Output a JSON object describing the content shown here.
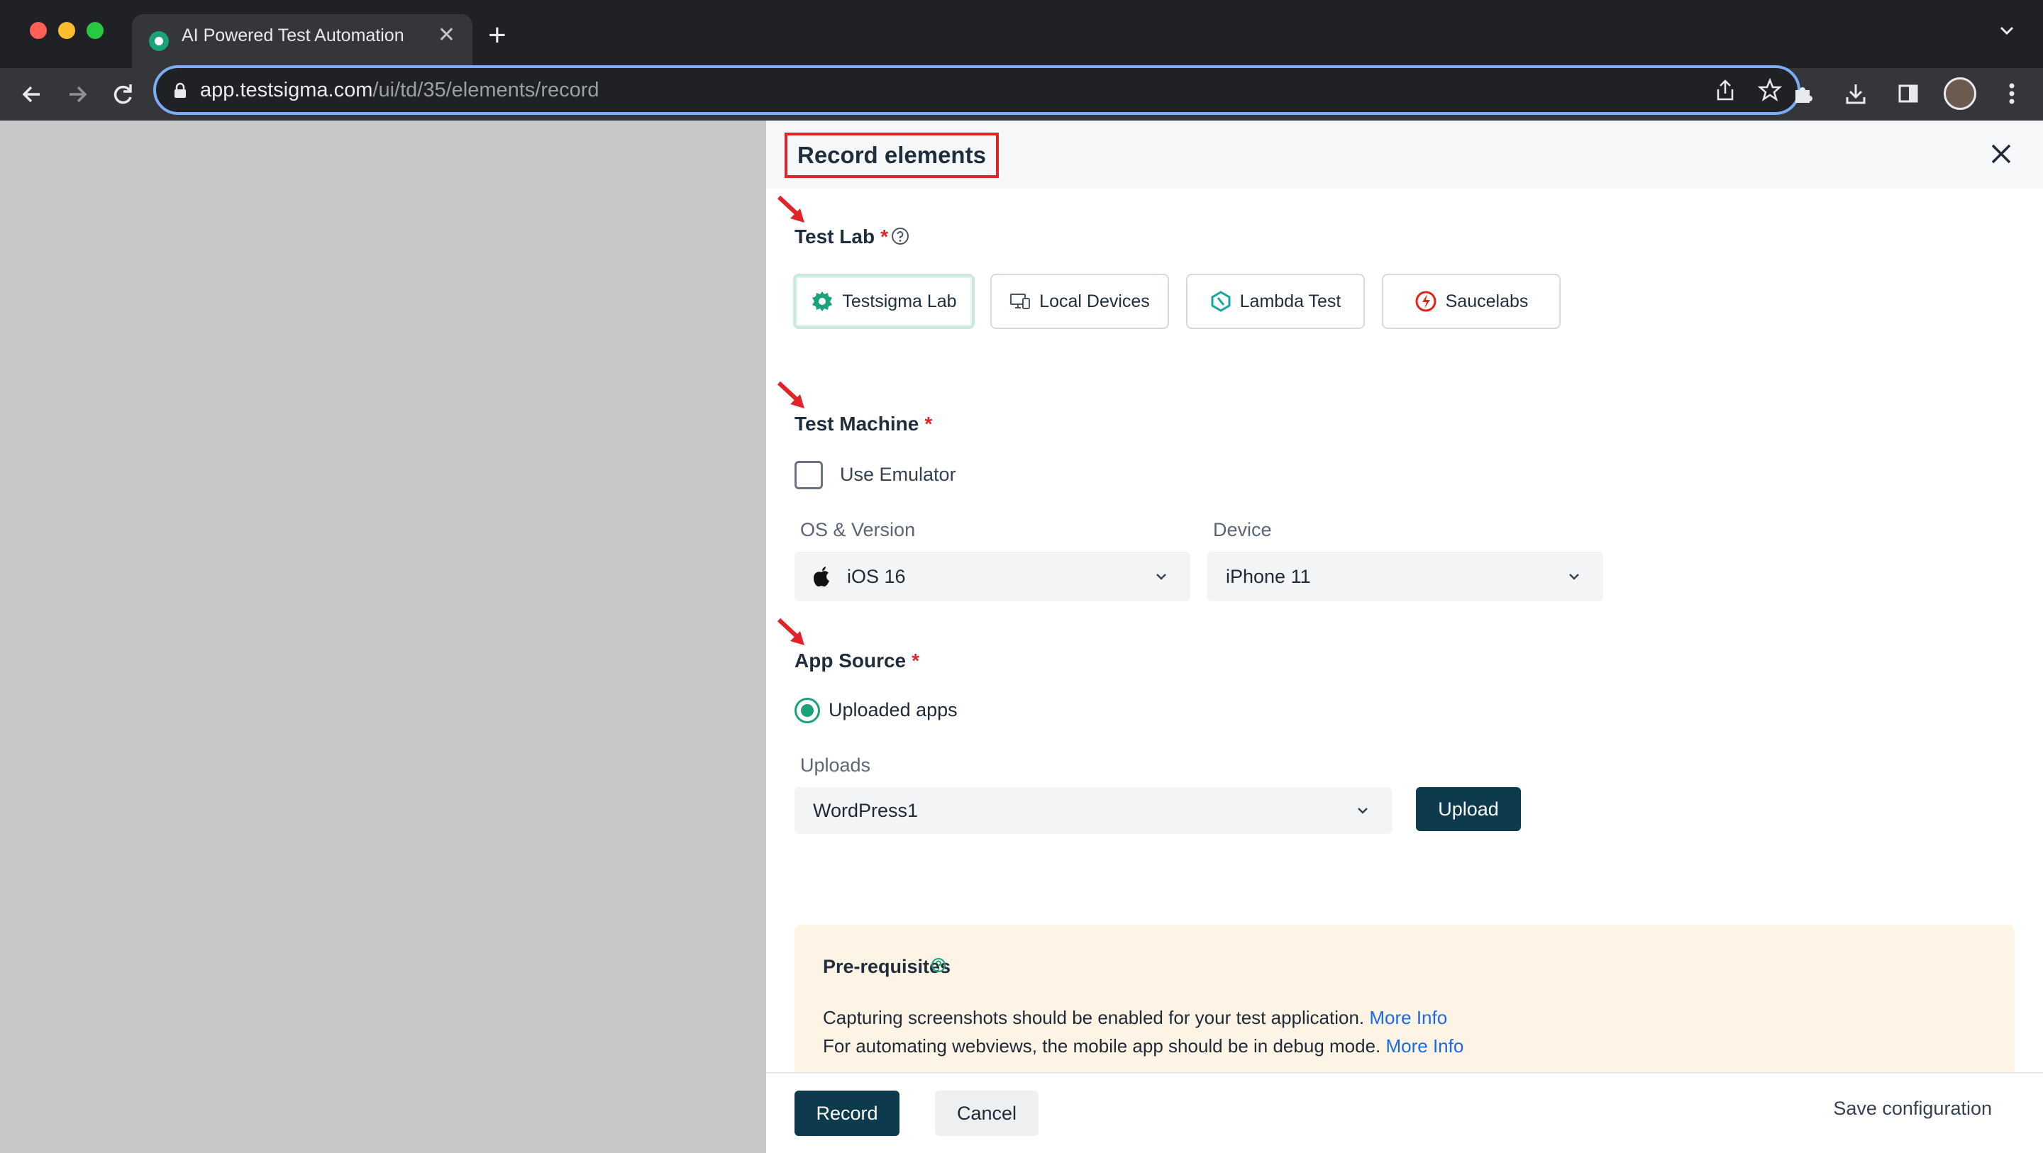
{
  "browser": {
    "tab_title": "AI Powered Test Automation Pl",
    "url_host": "app.testsigma.com",
    "url_path": "/ui/td/35/elements/record"
  },
  "panel": {
    "title": "Record elements",
    "test_lab": {
      "label": "Test Lab",
      "required_mark": "*",
      "options": [
        "Testsigma Lab",
        "Local Devices",
        "Lambda Test",
        "Saucelabs"
      ],
      "selected": "Testsigma Lab"
    },
    "test_machine": {
      "label": "Test Machine",
      "required_mark": "*",
      "emulator_label": "Use Emulator",
      "emulator_checked": false,
      "os_label": "OS & Version",
      "os_value": "iOS 16",
      "device_label": "Device",
      "device_value": "iPhone 11"
    },
    "app_source": {
      "label": "App Source",
      "required_mark": "*",
      "radio_label": "Uploaded apps",
      "uploads_label": "Uploads",
      "uploads_value": "WordPress1",
      "upload_button": "Upload"
    },
    "prerequisites": {
      "title": "Pre-requisites",
      "line1": "Capturing screenshots should be enabled for your test application.",
      "line1_link": "More Info",
      "line2": "For automating webviews, the mobile app should be in debug mode.",
      "line2_link": "More Info"
    },
    "footer": {
      "record": "Record",
      "cancel": "Cancel",
      "save_configuration": "Save configuration"
    }
  },
  "colors": {
    "primary_dark": "#0d3a4c",
    "accent_green": "#1aa37a",
    "required_red": "#e0242a",
    "link_blue": "#1a6ae6"
  }
}
